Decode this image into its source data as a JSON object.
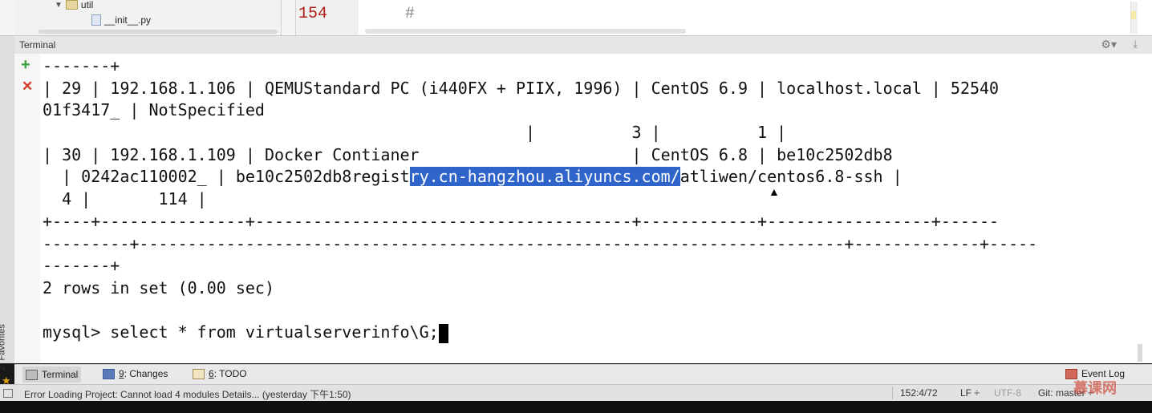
{
  "project_tree": {
    "folder_name": "util",
    "file_name": "__init__.py"
  },
  "editor": {
    "line_number": "154",
    "code": "#"
  },
  "terminal": {
    "title": "Terminal",
    "lines": [
      "-------+",
      "| 29 | 192.168.1.106 | QEMUStandard PC (i440FX + PIIX, 1996) | CentOS 6.9 | localhost.local | 52540",
      "01f3417_ | NotSpecified",
      "                                                  |          3 |          1 |",
      "| 30 | 192.168.1.109 | Docker Contianer                      | CentOS 6.8 | be10c2502db8",
      "  | 0242ac110002_ | be10c2502db8regist",
      "  4 |       114 |",
      "+----+---------------+---------------------------------------+------------+-----------------+------",
      "---------+-------------------------------------------------------------------------+-------------+-----",
      "-------+",
      "2 rows in set (0.00 sec)",
      "",
      "mysql> select * from virtualserverinfo\\G;"
    ],
    "line5_highlight": "ry.cn-hangzhou.aliyuncs.com/",
    "line5_rest": "atliwen/centos6.8-ssh |"
  },
  "side_panel": {
    "favorites_label": "2: Favorites"
  },
  "tool_windows": {
    "terminal": "Terminal",
    "changes_num": "9",
    "changes_label": ": Changes",
    "todo_num": "6",
    "todo_label": ": TODO",
    "event_log": "Event Log"
  },
  "status_bar": {
    "message": "Error Loading Project: Cannot load 4 modules Details... (yesterday 下午1:50)",
    "position": "152:4/72",
    "line_sep": "LF ÷",
    "encoding": "UTF-8",
    "git": "Git: master ÷"
  },
  "watermark": "慕课网",
  "colors": {
    "selection": "#2f65ca",
    "add_green": "#3aa13a",
    "close_red": "#d23a2a",
    "line_number_red": "#b0201a"
  }
}
